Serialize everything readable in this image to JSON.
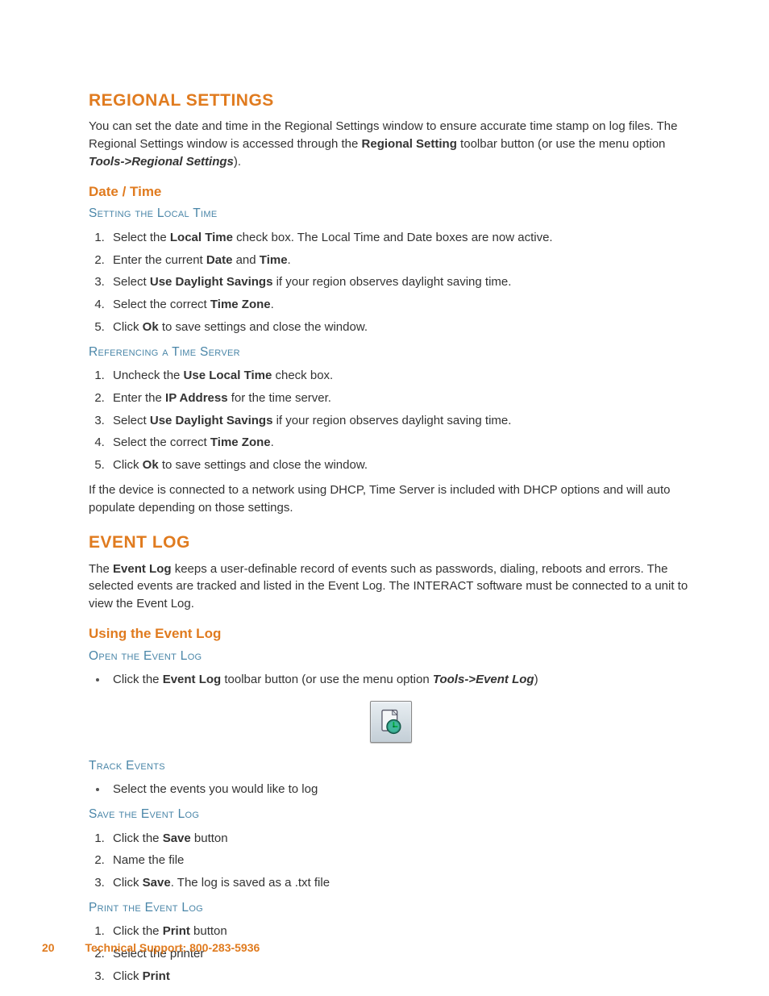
{
  "section1": {
    "title": "REGIONAL SETTINGS",
    "intro_a": "You can set the date and time in the Regional Settings window to ensure accurate time stamp on log files. The Regional Settings window is accessed through the ",
    "intro_b": "Regional Setting",
    "intro_c": " toolbar button (or use the menu option ",
    "intro_d": "Tools->Regional Settings",
    "intro_e": ").",
    "sub1": "Date / Time",
    "h3a": "Setting the Local Time",
    "list1": [
      {
        "a": "Select the ",
        "b": "Local Time",
        "c": " check box. The Local Time and Date boxes are now active."
      },
      {
        "a": "Enter the current ",
        "b": "Date",
        "c": " and ",
        "d": "Time",
        "e": "."
      },
      {
        "a": "Select ",
        "b": "Use Daylight Savings",
        "c": " if your region observes daylight saving time."
      },
      {
        "a": "Select the correct ",
        "b": "Time Zone",
        "c": "."
      },
      {
        "a": "Click ",
        "b": "Ok",
        "c": " to save settings and close the window."
      }
    ],
    "h3b": "Referencing a Time Server",
    "list2": [
      {
        "a": "Uncheck the ",
        "b": "Use Local Time",
        "c": " check box."
      },
      {
        "a": "Enter the ",
        "b": "IP Address",
        "c": " for the time server."
      },
      {
        "a": "Select ",
        "b": "Use Daylight Savings",
        "c": " if your region observes daylight saving time."
      },
      {
        "a": "Select the correct ",
        "b": "Time Zone",
        "c": "."
      },
      {
        "a": "Click ",
        "b": "Ok",
        "c": " to save settings and close the window."
      }
    ],
    "note": "If the device is connected to a network using DHCP, Time Server is included with DHCP options and will auto populate depending on those settings."
  },
  "section2": {
    "title": "EVENT LOG",
    "intro_a": "The ",
    "intro_b": "Event Log",
    "intro_c": " keeps a user-definable record of events such as passwords, dialing, reboots and errors. The selected events are tracked and listed in the Event Log. The INTERACT software must be connected to a unit to view the Event Log.",
    "sub1": "Using the Event Log",
    "h3a": "Open the Event Log",
    "open_a": "Click the ",
    "open_b": "Event Log",
    "open_c": " toolbar button (or use the menu option ",
    "open_d": "Tools->Event Log",
    "open_e": ")",
    "h3b": "Track Events",
    "track1": "Select the events you would like to log",
    "h3c": "Save the Event Log",
    "listSave": [
      {
        "a": "Click the ",
        "b": "Save",
        "c": " button"
      },
      {
        "a": "Name the file"
      },
      {
        "a": "Click ",
        "b": "Save",
        "c": ". The log is saved as a .txt file"
      }
    ],
    "h3d": "Print the Event Log",
    "listPrint": [
      {
        "a": "Click the ",
        "b": "Print",
        "c": " button"
      },
      {
        "a": "Select the printer"
      },
      {
        "a": "Click ",
        "b": "Print"
      }
    ]
  },
  "footer": {
    "page": "20",
    "support": "Technical Support:   800-283-5936"
  }
}
